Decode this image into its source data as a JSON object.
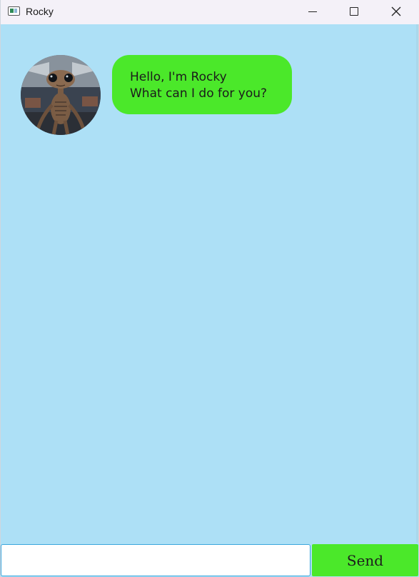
{
  "window": {
    "title": "Rocky",
    "icon": "app-window-icon",
    "controls": [
      "minimize-icon",
      "maximize-icon",
      "close-icon"
    ]
  },
  "chat": {
    "messages": [
      {
        "sender": "Rocky",
        "avatar": "alien-avatar",
        "lines": [
          "Hello, I'm Rocky",
          "What can I do for you?"
        ]
      }
    ]
  },
  "input": {
    "value": "",
    "placeholder": ""
  },
  "send_button": {
    "label": "Send"
  },
  "colors": {
    "background": "#ade0f6",
    "bubble": "#4be82a",
    "send_button": "#4be82a",
    "titlebar": "#f4f1f8",
    "input_border": "#3aa6dd"
  }
}
